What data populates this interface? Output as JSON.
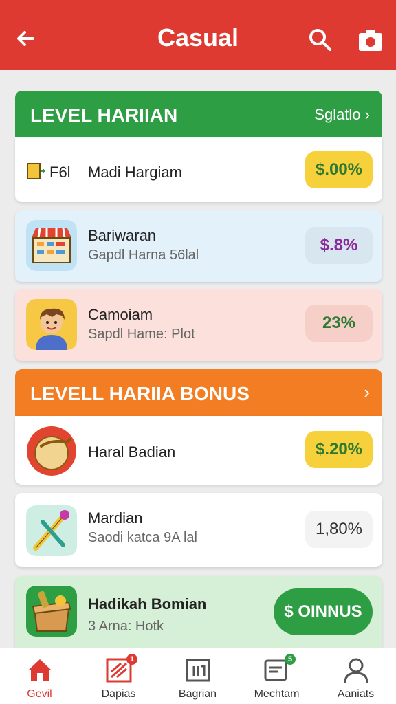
{
  "appbar": {
    "title": "Casual"
  },
  "section1": {
    "label": "LEVEL HARIIAN",
    "link": "Sglatlo ›",
    "items": [
      {
        "prefix": "F6l",
        "name": "Madi Hargiam",
        "value": "$.00%"
      },
      {
        "name": "Bariwaran",
        "sub": "Gapdl Harna 56lal",
        "value": "$.8%"
      },
      {
        "name": "Camoiam",
        "sub": "Sapdl Hame: Plot",
        "value": "23%"
      }
    ]
  },
  "section2": {
    "label": "LEVELL HARIIA BONUS",
    "link": "›",
    "items": [
      {
        "name": "Haral Badian",
        "value": "$.20%"
      },
      {
        "name": "Mardian",
        "sub": "Saodi katca 9A lal",
        "value": "1,80%"
      },
      {
        "name": "Hadikah Bomian",
        "sub": "3 Arna: Hotk",
        "value": "$ OINNUS"
      }
    ]
  },
  "nav": [
    {
      "label": "Gevil",
      "icon": "home-icon"
    },
    {
      "label": "Dapias",
      "icon": "grid-icon",
      "badge": "1"
    },
    {
      "label": "Bagrian",
      "icon": "calendar-icon"
    },
    {
      "label": "Mechtam",
      "icon": "chat-icon",
      "badge": "5"
    },
    {
      "label": "Aaniats",
      "icon": "profile-icon"
    }
  ],
  "colors": {
    "brand": "#de3a32",
    "green": "#2e9e44",
    "orange": "#f27d23"
  }
}
